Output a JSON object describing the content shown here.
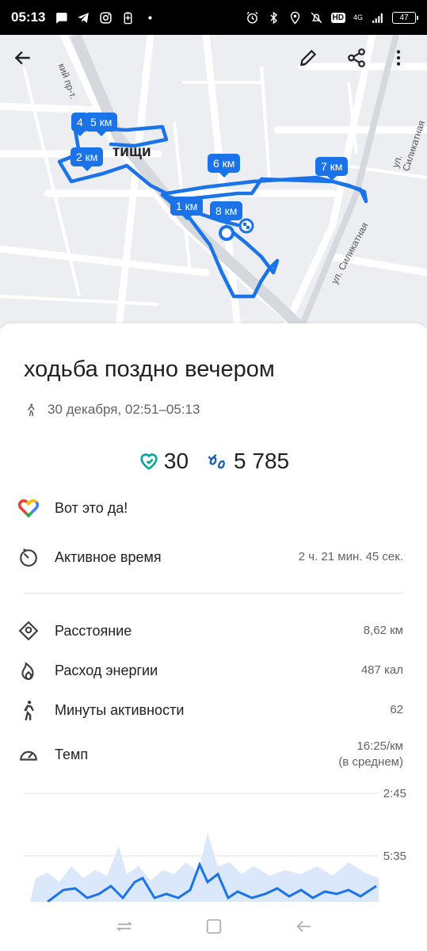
{
  "status_bar": {
    "time": "05:13",
    "network": "4G",
    "hd": "HD",
    "battery": "47"
  },
  "map": {
    "city_label": "тищи",
    "street_1": "ул. Силикатная",
    "street_2": "ул. Силикатная",
    "street_3": "кий пр-т.",
    "markers": [
      "1 км",
      "2 км",
      "4",
      "5 км",
      "6 км",
      "7 км",
      "8 км"
    ]
  },
  "activity": {
    "title": "ходьба поздно вечером",
    "datetime": "30 декабря, 02:51–05:13",
    "heart_points": "30",
    "steps": "5 785",
    "message": "Вот это да!"
  },
  "stats": {
    "active_time": {
      "label": "Активное время",
      "value": "2 ч. 21 мин. 45 сек."
    },
    "distance": {
      "label": "Расстояние",
      "value": "8,62 км"
    },
    "energy": {
      "label": "Расход энергии",
      "value": "487 кал"
    },
    "move_minutes": {
      "label": "Минуты активности",
      "value": "62"
    },
    "pace": {
      "label": "Темп",
      "value": "16:25/км",
      "value_note": "(в среднем)"
    }
  },
  "chart": {
    "y_top": "2:45",
    "y_mid": "5:35"
  },
  "colors": {
    "route": "#1a73e8",
    "heart_points": "#00a896",
    "steps": "#1a5fb4"
  }
}
